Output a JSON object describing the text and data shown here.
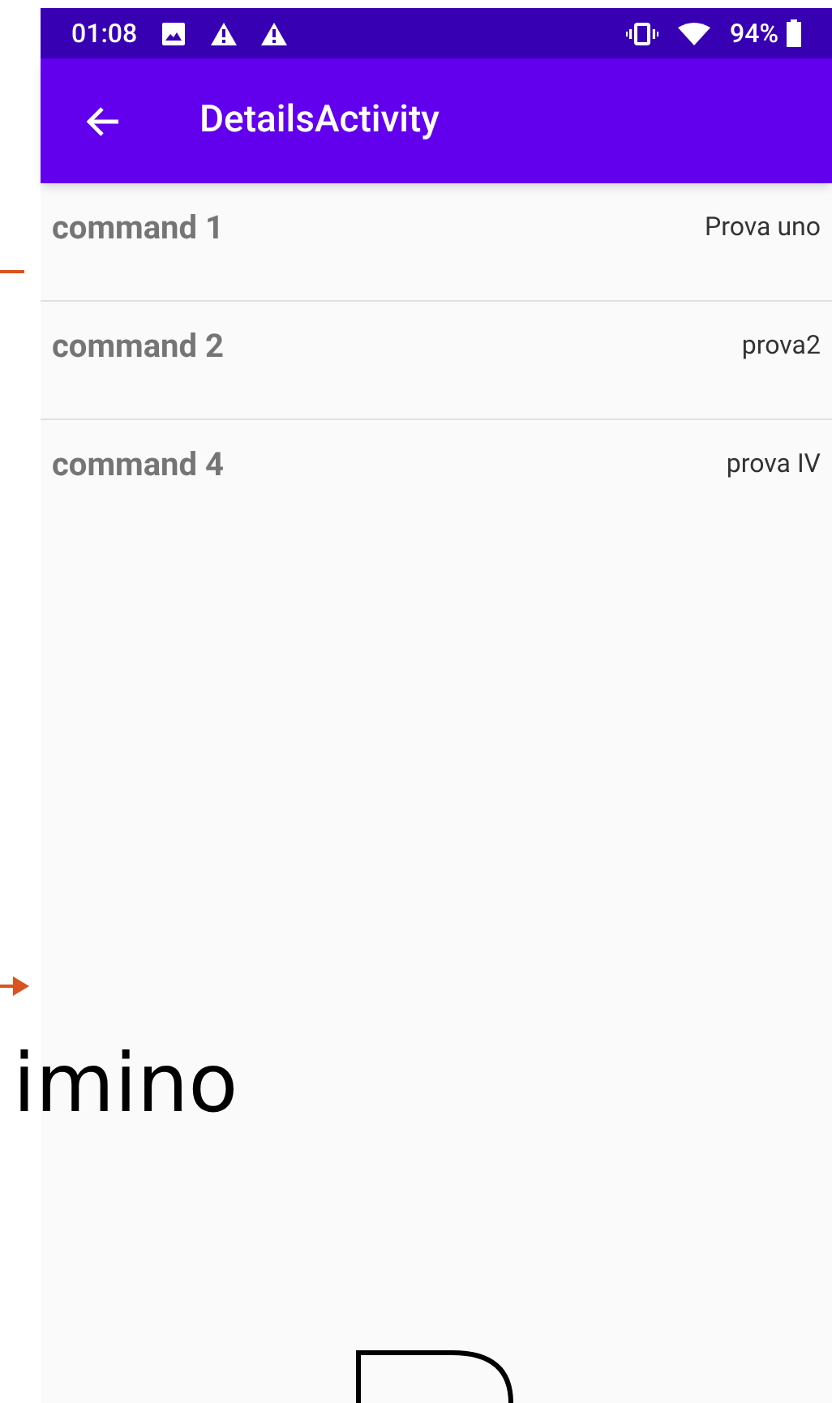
{
  "status_bar": {
    "time": "01:08",
    "battery": "94%"
  },
  "app_bar": {
    "title": "DetailsActivity"
  },
  "items": [
    {
      "name": "command 1",
      "value": "Prova uno"
    },
    {
      "name": "command 2",
      "value": "prova2"
    },
    {
      "name": "command 4",
      "value": "prova IV"
    }
  ],
  "overlay": {
    "text": "imino"
  }
}
